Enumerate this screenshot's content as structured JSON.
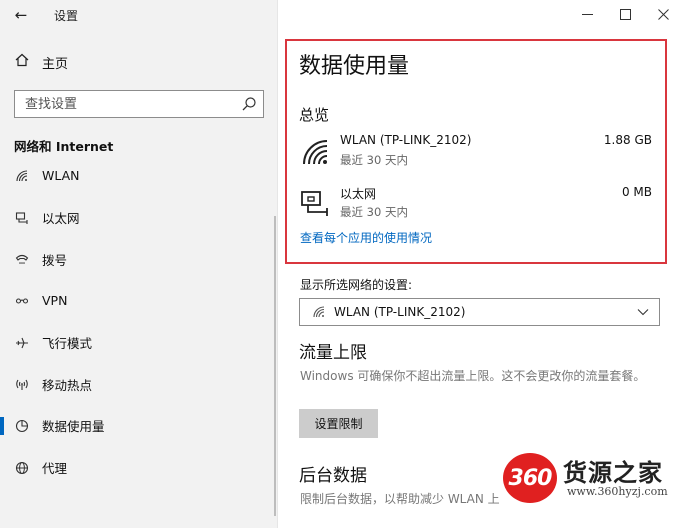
{
  "window": {
    "title": "设置"
  },
  "sidebar": {
    "home_label": "主页",
    "search_placeholder": "查找设置",
    "section_title": "网络和 Internet",
    "items": [
      {
        "label": "WLAN",
        "icon": "wifi-icon"
      },
      {
        "label": "以太网",
        "icon": "ethernet-icon"
      },
      {
        "label": "拨号",
        "icon": "dialup-icon"
      },
      {
        "label": "VPN",
        "icon": "vpn-icon"
      },
      {
        "label": "飞行模式",
        "icon": "airplane-icon"
      },
      {
        "label": "移动热点",
        "icon": "hotspot-icon"
      },
      {
        "label": "数据使用量",
        "icon": "data-usage-icon",
        "active": true
      },
      {
        "label": "代理",
        "icon": "globe-icon"
      }
    ]
  },
  "main": {
    "title": "数据使用量",
    "overview_title": "总览",
    "usage": [
      {
        "name": "WLAN (TP-LINK_2102)",
        "period": "最近 30 天内",
        "amount": "1.88 GB"
      },
      {
        "name": "以太网",
        "period": "最近 30 天内",
        "amount": "0 MB"
      }
    ],
    "per_app_link": "查看每个应用的使用情况",
    "network_select_label": "显示所选网络的设置:",
    "network_select_value": "WLAN (TP-LINK_2102)",
    "limit_title": "流量上限",
    "limit_desc": "Windows 可确保你不超出流量上限。这不会更改你的流量套餐。",
    "limit_button": "设置限制",
    "background_title": "后台数据",
    "background_desc": "限制后台数据，以帮助减少 WLAN 上"
  },
  "watermark": {
    "badge": "360",
    "brand": "货源之家",
    "url": "www.360hyzj.com"
  },
  "colors": {
    "accent": "#0067c0",
    "highlight_border": "#d9363e",
    "sidebar_bg": "#f2f2f2"
  }
}
